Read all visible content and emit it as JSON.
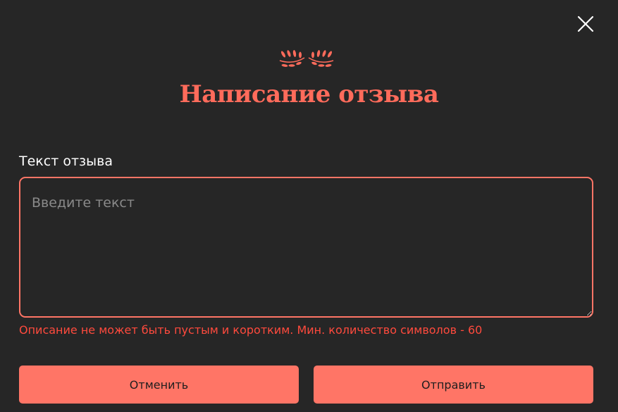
{
  "modal": {
    "title": "Написание отзыва",
    "field_label": "Текст отзыва",
    "textarea": {
      "value": "",
      "placeholder": "Введите текст"
    },
    "error_text": "Описание не может быть пустым и коротким. Мин. количество символов - 60",
    "buttons": {
      "cancel_label": "Отменить",
      "submit_label": "Отправить"
    },
    "icons": {
      "close": "close-icon",
      "ornament": "laurel-ornament-icon"
    },
    "colors": {
      "background": "#262626",
      "accent": "#ff7566",
      "title": "#ff6b5b",
      "error": "#ff4a3d",
      "button_text": "#1e1e1e"
    }
  }
}
